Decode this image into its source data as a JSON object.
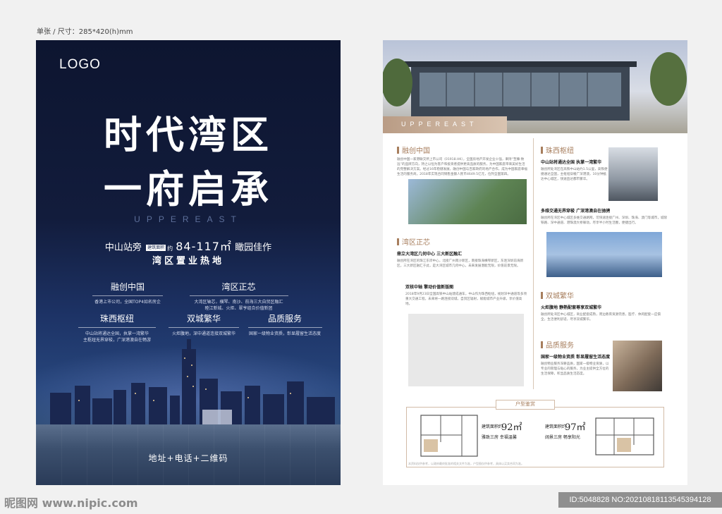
{
  "spec_line": "单张 / 尺寸：285*420(h)mm",
  "front": {
    "logo": "LOGO",
    "title_line1": "时代湾区",
    "title_line2": "一府启承",
    "english": "UPPEREAST",
    "station": "中山站旁",
    "area_tag": "建筑面积",
    "area_prefix": "约",
    "area": "84-117㎡",
    "area_suffix": "瞰园佳作",
    "hot": "湾区置业热地",
    "features": [
      {
        "title": "融创中国",
        "desc": "香港上市公司，全国TOP4如名房企"
      },
      {
        "title": "湾区正芯",
        "desc": "大湾区轴芯，横琴、南沙、前海三大自贸区融汇\n睦江新城、火炬、翠亨组合价值新团"
      },
      {
        "title": "珠西枢纽",
        "desc": "中山站将通达全国，执掌一湾繁华\n主枢纽无界穿梭，广深港澳自在畅游"
      },
      {
        "title": "双城繁华",
        "desc": "火炬腹地，深中通道连接双城繁华"
      },
      {
        "title": "品质服务",
        "desc": "国家一级物业资质，彰显履留生活态度"
      }
    ],
    "address": "地址+电话+二维码"
  },
  "back": {
    "band_en": "UPPEREAST",
    "sections": [
      {
        "title": "融创中国",
        "sub": "",
        "text": "融创中国一家港联交所上市公司（01918.HK），全国房地产开发企业十强，秉持“至臻·致远”的品牌方向，持之以恒为客户和投资者提供更高品质的服务，为中国家庭带来美好生活的完整解决方案。经过16年稳健发展，融创中国与百家政府的地产合作，成为中国家庭幸福生活的服务商，2018年实现合同销售金额人民币4649.5亿元，位列全国第四。"
      },
      {
        "title": "湾区正芯",
        "sub": "鼎立大湾区几何中心 三大新区融汇",
        "text": "融创所在湾区的珠江东岸中心，北接广州南沙新区，南接珠海横琴新区，东连深圳前海新区，三大新区融汇于此，是大湾区城市几何中心，未来发展潜能无限，价值前景无限。"
      },
      {
        "title": "",
        "sub": "双核中轴 擎动价值新版图",
        "text": "2018年9月23日全国高铁中山站建成通车，中山作为珠西枢纽，规划深中通道等多项重大交通工程，未来将一路连接双城，自贸区辐射，赋能城市产业升级，享价值高地。"
      },
      {
        "title": "珠西枢纽",
        "sub": "中山站将通达全国 执掌一湾繁华",
        "text": "融创所处湾区在高铁中山站约1.5公里，高铁便捷通达全国，主枢纽穿梭广深港澳，10分钟抵达中心城区，快速直达都市繁华。"
      },
      {
        "title": "",
        "sub": "多维交通无界穿梭 广深港澳自在驰骋",
        "text": "融创所在湾区中心城区多维交通路网，可快速连接广州、深圳、珠海、澳门等城市，城际铁路、深中通道、港珠澳大桥联动，尽享半小时生活圈，便捷出行。"
      },
      {
        "title": "双城繁华",
        "sub": "火炬腹地 静熟配套尊享双城繁华",
        "text": "融创所处湾区中心城区，商业配套成熟，周边教育资源完善，医疗、休闲配套一应俱全，生活便利舒适，尽享双城繁华。"
      },
      {
        "title": "品质服务",
        "sub": "国家一级物业资质 彰显履留生活态度",
        "text": "融创物业服务深耕品质，国家一级物业资质，以专业的管理与贴心的服务，为业主提供全方位的生活保障，彰显品质生活态度。"
      }
    ],
    "plans_title": "户型鉴赏",
    "plan_a": {
      "label": "建筑面积约",
      "area": "92㎡",
      "desc": "雅致三房 幸福温馨"
    },
    "plan_b": {
      "label": "建筑面积约",
      "area": "97㎡",
      "desc": "阔景三房 畅享阳光"
    },
    "footer_note": "本资料仅供参考，以政府最终批准的相关文件为准，户型图仅供参考，具体以买卖合同为准。"
  },
  "watermark": "昵图网 www.nipic.com",
  "id_text": "ID:5048828 NO:20210818113545394128"
}
